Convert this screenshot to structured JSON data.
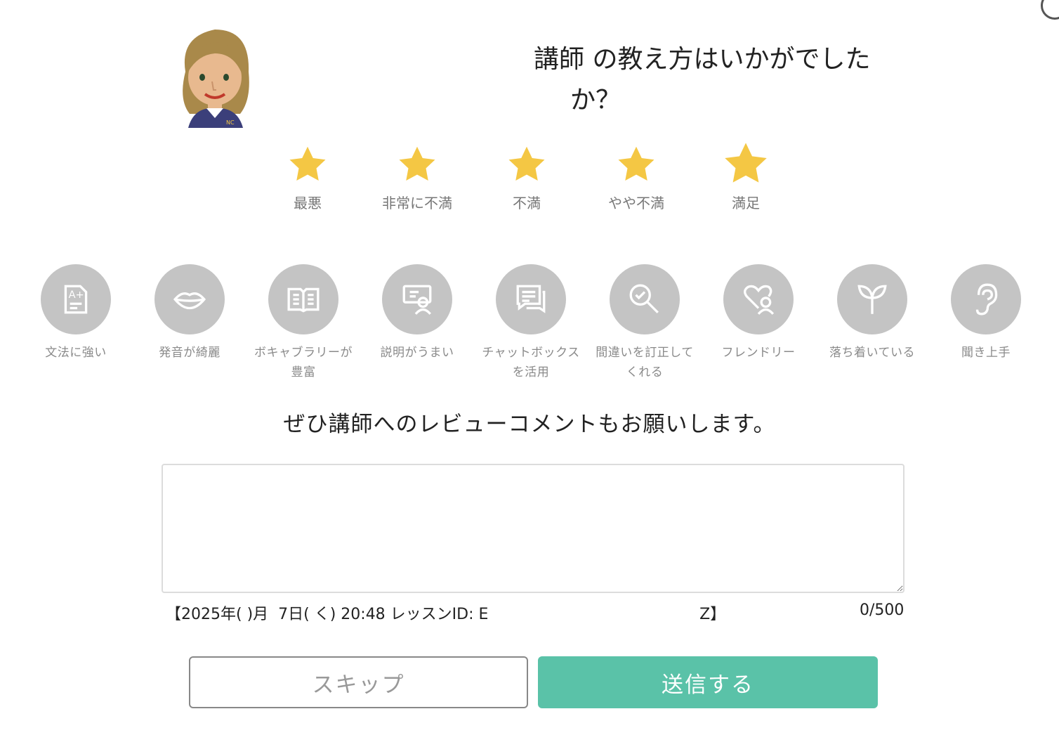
{
  "question": {
    "line1": "講師 の教え方はいかがでした",
    "line2": "か？"
  },
  "rating": {
    "star_color": "#f4c744",
    "options": [
      {
        "label": "最悪"
      },
      {
        "label": "非常に不満"
      },
      {
        "label": "不満"
      },
      {
        "label": "やや不満"
      },
      {
        "label": "満足"
      }
    ]
  },
  "tags": {
    "circle_color": "#c4c4c4",
    "items": [
      {
        "label": "文法に強い",
        "icon": "grade-document-icon"
      },
      {
        "label": "発音が綺麗",
        "icon": "lips-icon"
      },
      {
        "label": "ボキャブラリーが豊富",
        "icon": "open-book-icon"
      },
      {
        "label": "説明がうまい",
        "icon": "presenter-icon"
      },
      {
        "label": "チャットボックスを活用",
        "icon": "chat-box-icon"
      },
      {
        "label": "間違いを訂正してくれる",
        "icon": "magnifier-check-icon"
      },
      {
        "label": "フレンドリー",
        "icon": "heart-person-icon"
      },
      {
        "label": "落ち着いている",
        "icon": "sprout-icon"
      },
      {
        "label": "聞き上手",
        "icon": "ear-icon"
      }
    ]
  },
  "review": {
    "prompt": "ぜひ講師へのレビューコメントもお願いします。",
    "lesson_info": "【2025年( )月  7日( く) 20:48 レッスンID: E                                           Z】",
    "char_count": "0/500"
  },
  "buttons": {
    "skip": "スキップ",
    "submit": "送信する",
    "submit_color": "#5ac2a8"
  }
}
